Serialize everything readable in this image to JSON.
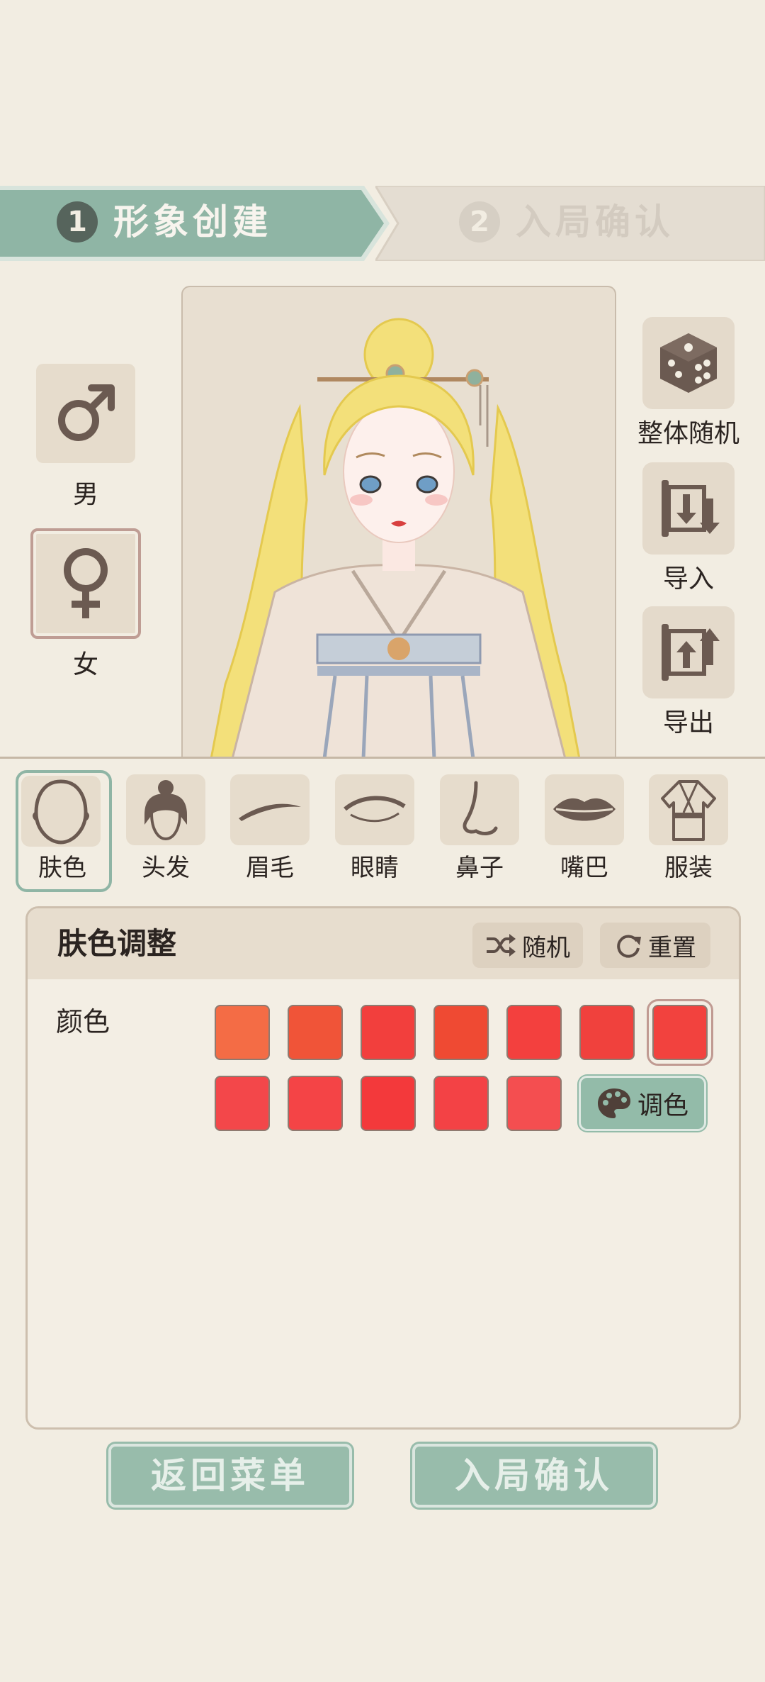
{
  "steps": [
    {
      "number": "1",
      "label": "形象创建",
      "active": true
    },
    {
      "number": "2",
      "label": "入局确认",
      "active": false
    }
  ],
  "gender": {
    "male": {
      "label": "男",
      "icon": "male-symbol-icon"
    },
    "female": {
      "label": "女",
      "icon": "female-symbol-icon",
      "selected": true
    }
  },
  "actions": {
    "random": {
      "label": "整体随机",
      "icon": "dice-icon"
    },
    "import": {
      "label": "导入",
      "icon": "scroll-import-icon"
    },
    "export": {
      "label": "导出",
      "icon": "scroll-export-icon"
    }
  },
  "categories": [
    {
      "label": "肤色",
      "icon": "face-outline-icon",
      "selected": true
    },
    {
      "label": "头发",
      "icon": "hair-bun-icon"
    },
    {
      "label": "眉毛",
      "icon": "eyebrow-icon"
    },
    {
      "label": "眼睛",
      "icon": "eye-icon"
    },
    {
      "label": "鼻子",
      "icon": "nose-icon"
    },
    {
      "label": "嘴巴",
      "icon": "lips-icon"
    },
    {
      "label": "服装",
      "icon": "robe-icon"
    }
  ],
  "panel": {
    "title": "肤色调整",
    "random_label": "随机",
    "reset_label": "重置",
    "color_label": "颜色",
    "palette_label": "调色",
    "swatches_row1": [
      "#f46c45",
      "#f05438",
      "#f23f3d",
      "#ef4a33",
      "#f3403e",
      "#f0413d",
      "#f2423e"
    ],
    "swatches_row2": [
      "#f3474a",
      "#f44446",
      "#f3393b",
      "#f34245",
      "#f44e50"
    ],
    "selected_swatch_index": 6
  },
  "buttons": {
    "back": "返回菜单",
    "confirm": "入局确认"
  },
  "colors": {
    "accent_green": "#8fb5a5",
    "background": "#f2ede2",
    "tile": "#e6dccc",
    "icon_brown": "#6b5a51"
  }
}
